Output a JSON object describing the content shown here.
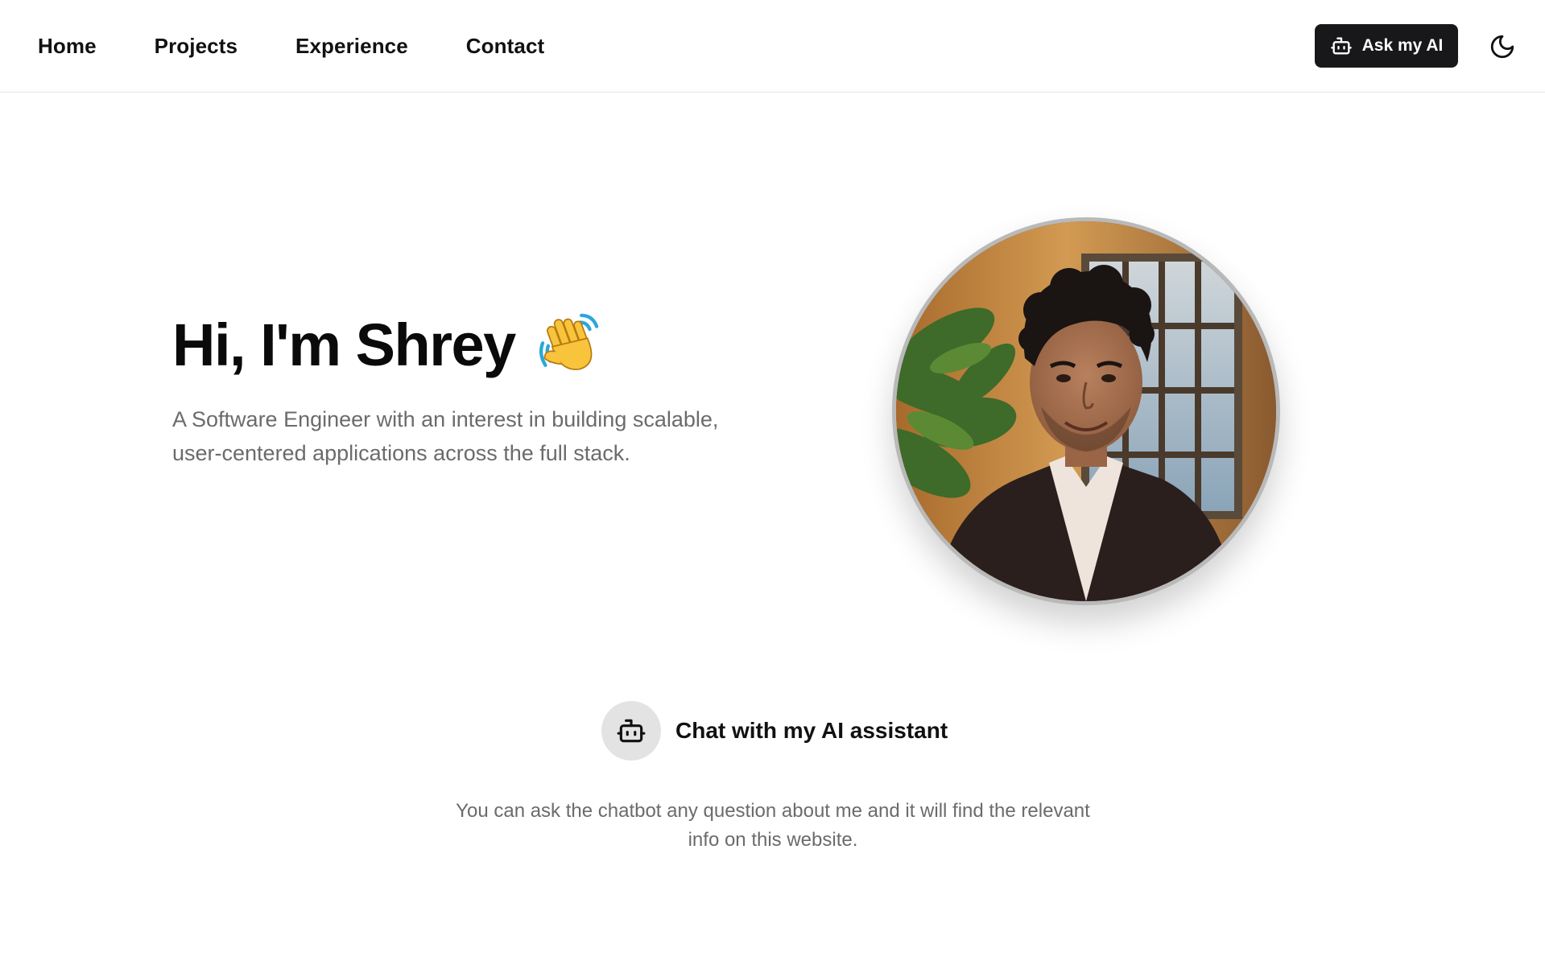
{
  "nav": {
    "links": [
      "Home",
      "Projects",
      "Experience",
      "Contact"
    ],
    "ask_ai_label": "Ask my AI",
    "ask_ai_icon": "bot-icon",
    "theme_toggle_icon": "moon-icon"
  },
  "hero": {
    "title": "Hi, I'm Shrey",
    "title_icon": "waving-hand-icon",
    "subtitle": "A Software Engineer with an interest in building scalable, user-centered applications across the full stack.",
    "avatar": "profile-photo"
  },
  "chat": {
    "icon": "bot-icon",
    "title": "Chat with my AI assistant",
    "description": "You can ask the chatbot any question about me and it will find the relevant info on this website."
  },
  "colors": {
    "text_primary": "#111111",
    "text_muted": "#6b6b6b",
    "button_dark": "#18181b",
    "chat_icon_bg": "#e3e3e3",
    "border": "#e6e6e6"
  }
}
